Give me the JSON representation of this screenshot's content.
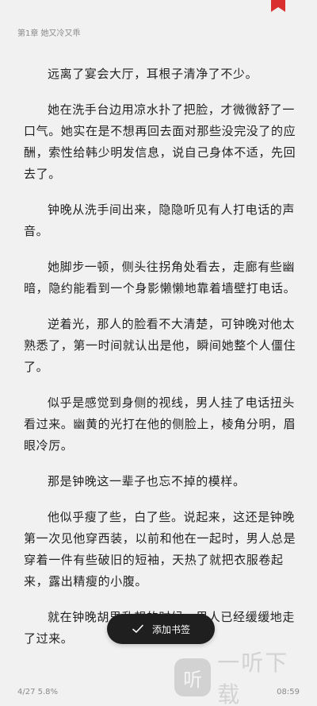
{
  "header": {
    "chapter": "第1章 她又冷又乖"
  },
  "paragraphs": [
    "远离了宴会大厅，耳根子清净了不少。",
    "她在洗手台边用凉水扑了把脸，才微微舒了一口气。她实在是不想再回去面对那些没完没了的应酬，索性给韩少明发信息，说自己身体不适，先回去了。",
    "钟晚从洗手间出来，隐隐听见有人打电话的声音。",
    "她脚步一顿，侧头往拐角处看去，走廊有些幽暗，隐约能看到一个身影懒懒地靠着墙壁打电话。",
    "逆着光，那人的脸看不大清楚，可钟晚对他太熟悉了，第一时间就认出是他，瞬间她整个人僵住了。",
    "似乎是感觉到身侧的视线，男人挂了电话扭头看过来。幽黄的光打在他的侧脸上，棱角分明，眉眼冷厉。",
    "那是钟晚这一辈子也忘不掉的模样。",
    "他似乎瘦了些，白了些。说起来，这还是钟晚第一次见他穿西装，以前和他在一起时，男人总是穿着一件有些破旧的短袖，天热了就把衣服卷起来，露出精瘦的小腹。",
    "就在钟晚胡思乱想的时候，男人已经缓缓地走了过来。"
  ],
  "toast": {
    "label": "添加书签",
    "icon": "check-icon"
  },
  "footer": {
    "progress": "4/27  5.8%",
    "time": "08:59"
  },
  "watermark": {
    "icon_glyph": "听",
    "text": "一听下载"
  },
  "colors": {
    "bookmark": "#d9302f",
    "toast_bg": "#1f1f1f",
    "background": "#f1f1f1"
  }
}
